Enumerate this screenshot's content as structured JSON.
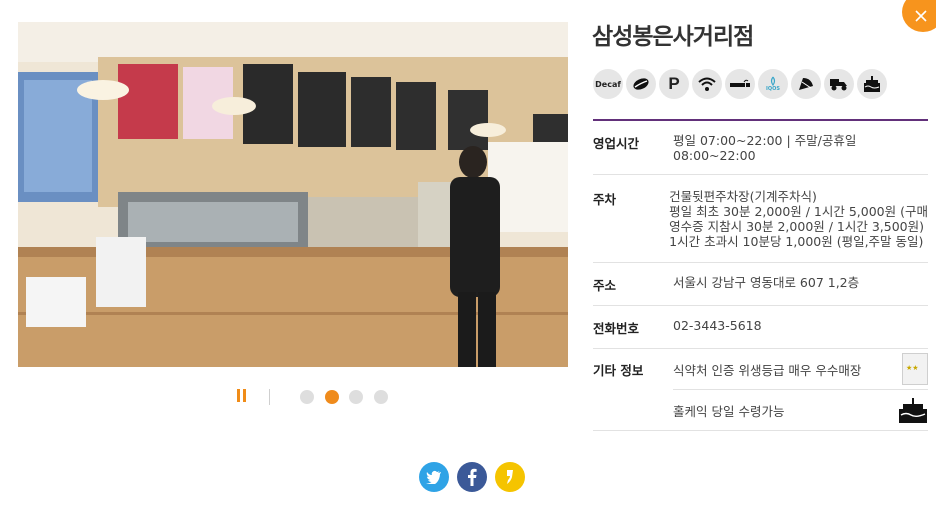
{
  "store": {
    "name": "삼성봉은사거리점"
  },
  "amenities": [
    {
      "icon": "decaf-icon",
      "label": "Decaf"
    },
    {
      "icon": "bean-icon",
      "label": ""
    },
    {
      "icon": "parking-icon",
      "label": "P"
    },
    {
      "icon": "wifi-icon",
      "label": ""
    },
    {
      "icon": "smoking-icon",
      "label": ""
    },
    {
      "icon": "iqos-icon",
      "label": "IQOS"
    },
    {
      "icon": "leaf-icon",
      "label": ""
    },
    {
      "icon": "delivery-icon",
      "label": ""
    },
    {
      "icon": "cake-icon",
      "label": ""
    }
  ],
  "info": {
    "hours_label": "영업시간",
    "hours_value": "평일 07:00~22:00 | 주말/공휴일 08:00~22:00",
    "parking_label": "주차",
    "parking_lines": [
      "건물뒷편주차장(기계주차식)",
      "평일 최초 30분 2,000원 / 1시간 5,000원 (구매",
      "영수증 지참시 30분 2,000원 / 1시간 3,500원)",
      "1시간 초과시 10분당 1,000원 (평일,주말 동일)"
    ],
    "address_label": "주소",
    "address_value": "서울시 강남구 영동대로 607 1,2층",
    "phone_label": "전화번호",
    "phone_value": "02-3443-5618",
    "etc_label": "기타 정보",
    "etc_items": [
      {
        "text": "식약처 인증 위생등급 매우 우수매장",
        "icon": "hygiene-grade-icon"
      },
      {
        "text": "홀케익 당일 수령가능",
        "icon": "cake-icon"
      }
    ]
  },
  "carousel": {
    "active_index": 1,
    "total": 4
  },
  "share": [
    {
      "icon": "twitter-icon",
      "color": "#2fa3e6"
    },
    {
      "icon": "facebook-icon",
      "color": "#3b5998"
    },
    {
      "icon": "kakaostory-icon",
      "color": "#f5c400"
    }
  ],
  "colors": {
    "accent": "#f08c18",
    "table_border": "#62307a"
  }
}
